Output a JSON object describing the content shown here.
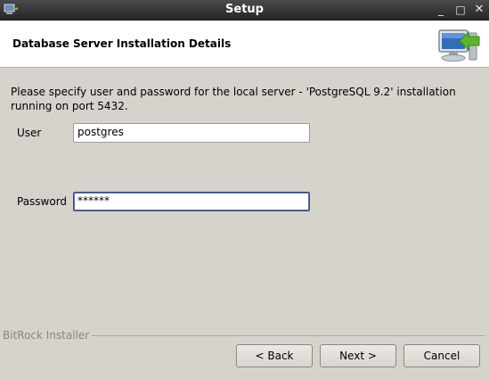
{
  "window": {
    "title": "Setup",
    "minimize_glyph": "_",
    "maximize_glyph": "□",
    "close_glyph": "✕"
  },
  "header": {
    "title": "Database Server Installation Details",
    "icon": "computer-install-icon"
  },
  "body": {
    "description": "Please specify user and password for the local server - 'PostgreSQL 9.2' installation running on port 5432.",
    "user_label": "User",
    "user_value": "postgres",
    "password_label": "Password",
    "password_value": "******"
  },
  "footer": {
    "brand": "BitRock Installer",
    "back_label": "< Back",
    "next_label": "Next >",
    "cancel_label": "Cancel"
  },
  "colors": {
    "titlebar": "#2e2e2e",
    "window_bg": "#d6d2cc",
    "header_bg": "#ffffff",
    "focus_border": "#3a4f7a"
  }
}
